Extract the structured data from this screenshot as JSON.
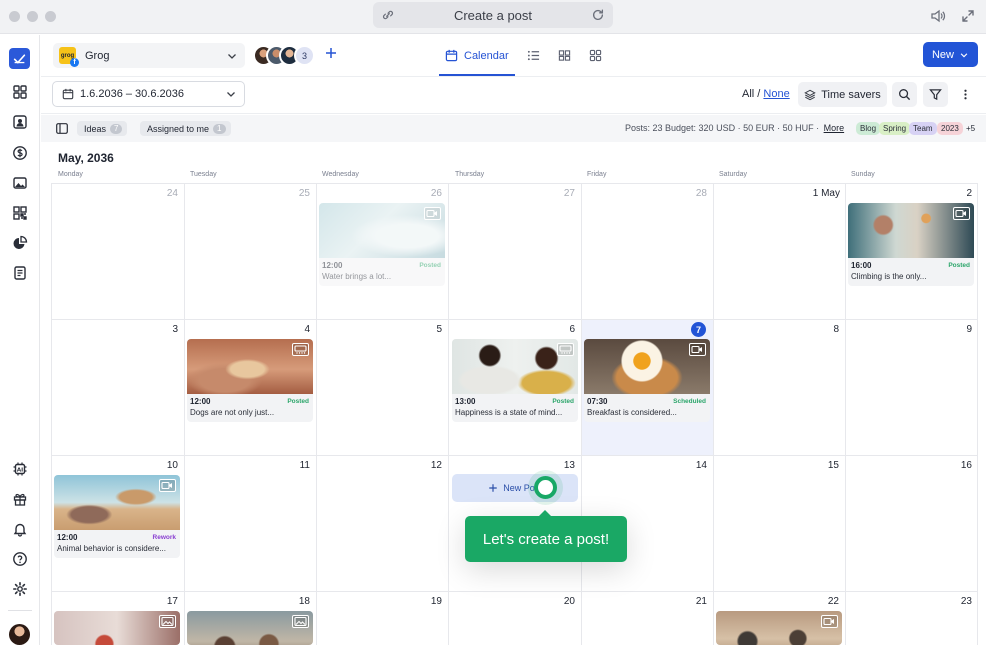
{
  "browser": {
    "title": "Create a post"
  },
  "header": {
    "profile_name": "Grog",
    "brand_logo_text": "grog",
    "member_count": "3",
    "tabs": [
      {
        "label": "Calendar",
        "icon": "calendar-icon"
      },
      {
        "label": "",
        "icon": "list-icon"
      },
      {
        "label": "",
        "icon": "feed-icon"
      },
      {
        "label": "",
        "icon": "grid-icon"
      }
    ],
    "new_label": "New"
  },
  "toolbar": {
    "date_range": "1.6.2036 – 30.6.2036",
    "all_label": "All /",
    "none_label": "None",
    "time_savers": "Time savers"
  },
  "filters": {
    "ideas_label": "Ideas",
    "ideas_count": "7",
    "assigned_label": "Assigned to me",
    "assigned_count": "1",
    "stats_text": "Posts: 23   Budget: 320 USD · 50 EUR · 50 HUF ·",
    "more_label": "More",
    "tags": [
      {
        "label": "Blog",
        "color": "#cdebd6"
      },
      {
        "label": "Spring",
        "color": "#d9efc6"
      },
      {
        "label": "Team",
        "color": "#d7d2f4"
      },
      {
        "label": "2023",
        "color": "#f6d3d8"
      }
    ],
    "more_tags": "+5"
  },
  "calendar": {
    "month": "May, 2036",
    "weekdays": [
      "Monday",
      "Tuesday",
      "Wednesday",
      "Thursday",
      "Friday",
      "Saturday",
      "Sunday"
    ],
    "weeks": [
      [
        "24",
        "25",
        "26",
        "27",
        "28",
        "1 May",
        "2"
      ],
      [
        "3",
        "4",
        "5",
        "6",
        "7",
        "8",
        "9"
      ],
      [
        "10",
        "11",
        "12",
        "13",
        "14",
        "15",
        "16"
      ],
      [
        "17",
        "18",
        "19",
        "20",
        "21",
        "22",
        "23"
      ]
    ],
    "posts": {
      "wed26": {
        "time": "12:00",
        "status": "Posted",
        "text": "Water brings a lot..."
      },
      "sun2": {
        "time": "16:00",
        "status": "Posted",
        "text": "Climbing is the only..."
      },
      "tue4": {
        "time": "12:00",
        "status": "Posted",
        "text": "Dogs are not only just..."
      },
      "thu6": {
        "time": "13:00",
        "status": "Posted",
        "text": "Happiness is a state of mind..."
      },
      "fri7": {
        "time": "07:30",
        "status": "Scheduled",
        "text": "Breakfast is considered..."
      },
      "mon10": {
        "time": "12:00",
        "status": "Rework",
        "text": "Animal behavior is considere..."
      }
    },
    "new_post_label": "New Post",
    "tooltip": "Let's create a post!"
  },
  "colors": {
    "accent": "#2254d6",
    "success": "#1aa865",
    "rework": "#8a3fd1"
  }
}
